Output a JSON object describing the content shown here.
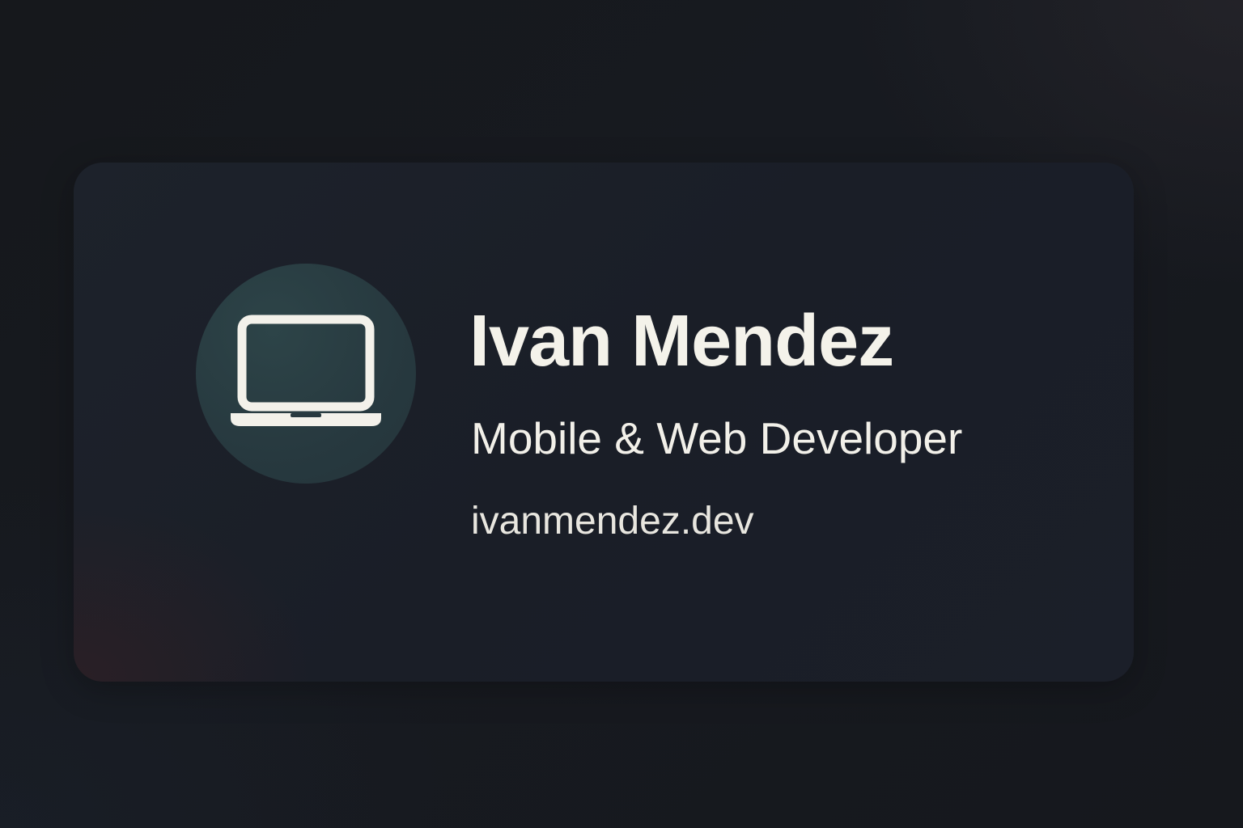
{
  "profile": {
    "name": "Ivan Mendez",
    "title": "Mobile & Web Developer",
    "website": "ivanmendez.dev"
  },
  "icons": {
    "avatar_icon": "laptop-icon"
  },
  "colors": {
    "background": "#16181c",
    "card": "#1c2029",
    "avatar_circle": "#28393f",
    "text": "#f4f2ea"
  }
}
